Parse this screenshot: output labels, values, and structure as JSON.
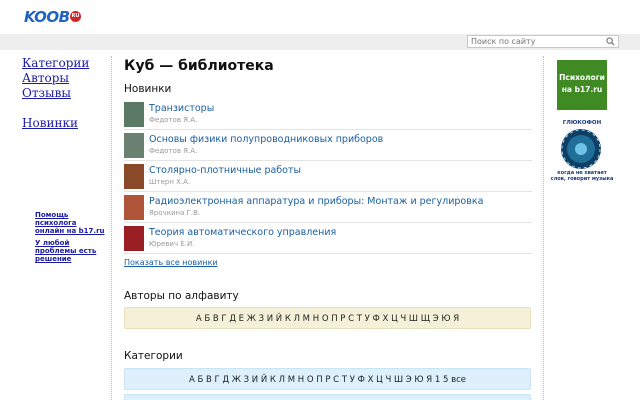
{
  "header": {
    "logo_text": "KOOB",
    "logo_badge": "RU",
    "search_placeholder": "Поиск по сайту"
  },
  "left_nav": {
    "items": [
      "Категории",
      "Авторы",
      "Отзывы"
    ],
    "new_label": "Новинки",
    "promo1": "Помощь психолога онлайн на b17.ru",
    "promo2": "У любой проблемы есть решение"
  },
  "main": {
    "title": "Куб — библиотека",
    "new_section": "Новинки",
    "books": [
      {
        "title": "Транзисторы",
        "author": "Федотов Я.А.",
        "cover": "#5b7a65"
      },
      {
        "title": "Основы физики полупроводниковых приборов",
        "author": "Федотов Я.А.",
        "cover": "#6a8070"
      },
      {
        "title": "Столярно-плотничные работы",
        "author": "Штерн Х.А.",
        "cover": "#8a4a2a"
      },
      {
        "title": "Радиоэлектронная аппаратура и приборы: Монтаж и регулировка",
        "author": "Ярочкина Г.В.",
        "cover": "#b0553a"
      },
      {
        "title": "Теория автоматического управления",
        "author": "Юревич Е.И.",
        "cover": "#9a1f24"
      }
    ],
    "show_all": "Показать все новинки",
    "authors_title": "Авторы по алфавиту",
    "authors_letters": "А Б В Г Д Е Ж З И Й К Л М Н О П Р С Т У Ф Х Ц Ч Ш Щ Э Ю Я",
    "categories_title": "Категории",
    "categories_letters": "А Б В Г Д Ж З И Й К Л М Н О П Р С Т У Ф Х Ц Ч Ш Э Ю Я 1 5 все"
  },
  "right": {
    "banner": "Психологи на b17.ru",
    "gluko_title": "ГЛЮКОФОН",
    "gluko_sub": "когда не хватает слов, говорит музыка"
  },
  "colors": {
    "link": "#1a5fa0",
    "banner_green": "#3f8a22",
    "authors_bg": "#f5f1d9",
    "categories_bg": "#ddf0fb"
  }
}
